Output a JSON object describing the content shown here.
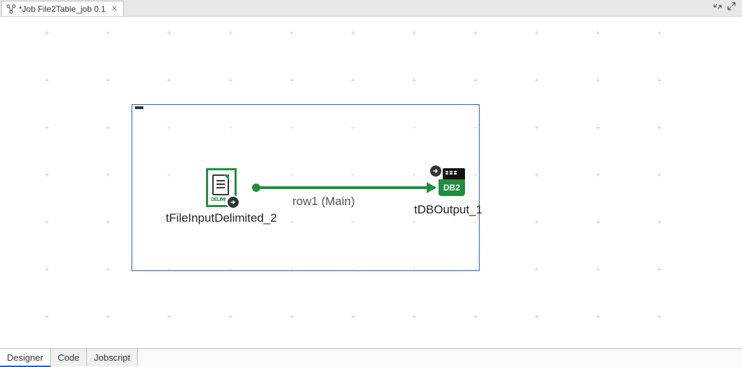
{
  "tab": {
    "title": "*Job File2Table_job 0.1"
  },
  "canvas": {
    "subjob": {
      "selected": true
    },
    "components": {
      "file_input": {
        "label": "tFileInputDelimited_2",
        "delim_tag": "DELIMI"
      },
      "db_output": {
        "label": "tDBOutput_1",
        "db_tag": "DB2"
      }
    },
    "connection": {
      "label": "row1 (Main)"
    }
  },
  "bottom_tabs": {
    "designer": "Designer",
    "code": "Code",
    "jobscript": "Jobscript",
    "active": "designer"
  }
}
